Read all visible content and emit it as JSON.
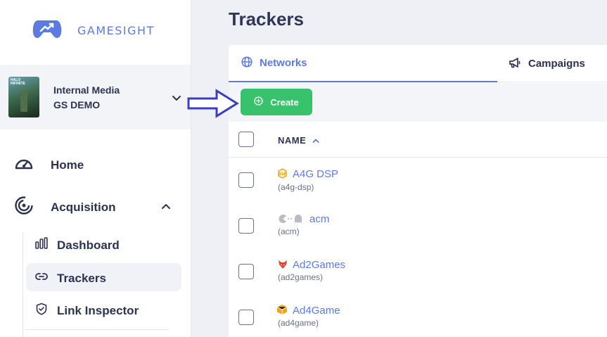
{
  "brand": {
    "name": "GAMESIGHT",
    "icon": "gamepad-logo-icon"
  },
  "org": {
    "name": "Internal Media",
    "sub": "GS DEMO",
    "thumb_text": "HALO INFINITE"
  },
  "nav": {
    "home": "Home",
    "acquisition": "Acquisition",
    "sub_items": [
      "Dashboard",
      "Trackers",
      "Link Inspector"
    ]
  },
  "page": {
    "title": "Trackers"
  },
  "tabs": {
    "networks": "Networks",
    "campaigns": "Campaigns"
  },
  "toolbar": {
    "create": "Create"
  },
  "table": {
    "header_name": "NAME",
    "rows": [
      {
        "title": "A4G DSP",
        "slug": "(a4g-dsp)"
      },
      {
        "title": "acm",
        "slug": "(acm)"
      },
      {
        "title": "Ad2Games",
        "slug": "(ad2games)"
      },
      {
        "title": "Ad4Game",
        "slug": "(ad4game)"
      }
    ]
  },
  "colors": {
    "accent": "#5b7be0",
    "create": "#37c26b",
    "arrow": "#3b3fbf"
  }
}
